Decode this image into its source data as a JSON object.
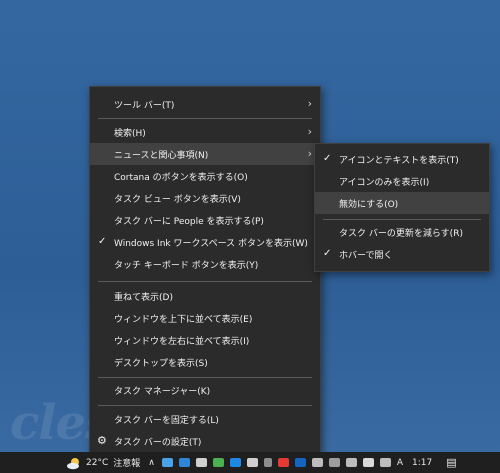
{
  "menu": {
    "toolbar": "ツール バー(T)",
    "search": "検索(H)",
    "news": "ニュースと関心事項(N)",
    "cortana": "Cortana のボタンを表示する(O)",
    "taskview": "タスク ビュー ボタンを表示(V)",
    "people": "タスク バーに People を表示する(P)",
    "ink": "Windows Ink ワークスペース ボタンを表示(W)",
    "keyboard": "タッチ キーボード ボタンを表示(Y)",
    "cascade": "重ねて表示(D)",
    "stack": "ウィンドウを上下に並べて表示(E)",
    "side": "ウィンドウを左右に並べて表示(I)",
    "desktop": "デスクトップを表示(S)",
    "taskmgr": "タスク マネージャー(K)",
    "lock": "タスク バーを固定する(L)",
    "settings": "タスク バーの設定(T)"
  },
  "submenu": {
    "icon_text": "アイコンとテキストを表示(T)",
    "icon_only": "アイコンのみを表示(I)",
    "disable": "無効にする(O)",
    "reduce": "タスク バーの更新を減らす(R)",
    "hover": "ホバーで開く"
  },
  "glyphs": {
    "check": "✓",
    "arrow": "›",
    "gear": "⚙",
    "up": "∧",
    "notify": "▤"
  },
  "taskbar": {
    "temp": "22°C",
    "weather": "注意報",
    "ime": "A",
    "time": "1:17"
  },
  "colors": {
    "menu_bg": "#2b2b2b",
    "highlight": "#414141",
    "desktop": "#2f5f97"
  }
}
